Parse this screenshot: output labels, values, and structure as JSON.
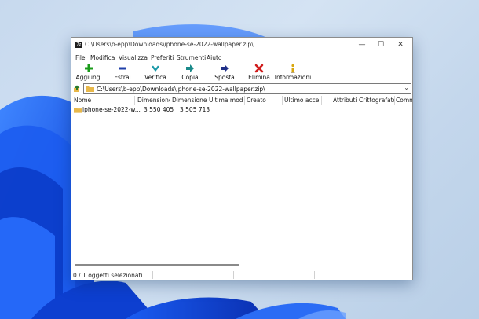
{
  "window": {
    "title": "C:\\Users\\b-epp\\Downloads\\iphone-se-2022-wallpaper.zip\\",
    "app_icon_text": "7z",
    "controls": {
      "minimize": "—",
      "maximize": "☐",
      "close": "✕"
    }
  },
  "menu": [
    "File",
    "Modifica",
    "Visualizza",
    "Preferiti",
    "Strumenti",
    "Aiuto"
  ],
  "toolbar": [
    {
      "label": "Aggiungi",
      "icon": "plus-icon",
      "color": "#1a9b1a"
    },
    {
      "label": "Estrai",
      "icon": "minus-icon",
      "color": "#1f3fa8"
    },
    {
      "label": "Verifica",
      "icon": "check-icon",
      "color": "#1b9aa8"
    },
    {
      "label": "Copia",
      "icon": "copy-arrow-icon",
      "color": "#1b8a8a"
    },
    {
      "label": "Sposta",
      "icon": "move-arrow-icon",
      "color": "#1f2f88"
    },
    {
      "label": "Elimina",
      "icon": "delete-x-icon",
      "color": "#d01c1c"
    },
    {
      "label": "Informazioni",
      "icon": "info-icon",
      "color": "#d8a60c"
    }
  ],
  "address": {
    "path": "C:\\Users\\b-epp\\Downloads\\iphone-se-2022-wallpaper.zip\\",
    "dropdown": "⌄"
  },
  "columns": [
    "Nome",
    "Dimensione",
    "Dimensione...",
    "Ultima mod...",
    "Creato",
    "Ultimo acce...",
    "Attributi",
    "Crittografato",
    "Comm"
  ],
  "rows": [
    {
      "name": "iphone-se-2022-w...",
      "size": "3 550 405",
      "packed": "3 505 713"
    }
  ],
  "status": {
    "selection": "0 / 1 oggetti selezionati"
  }
}
